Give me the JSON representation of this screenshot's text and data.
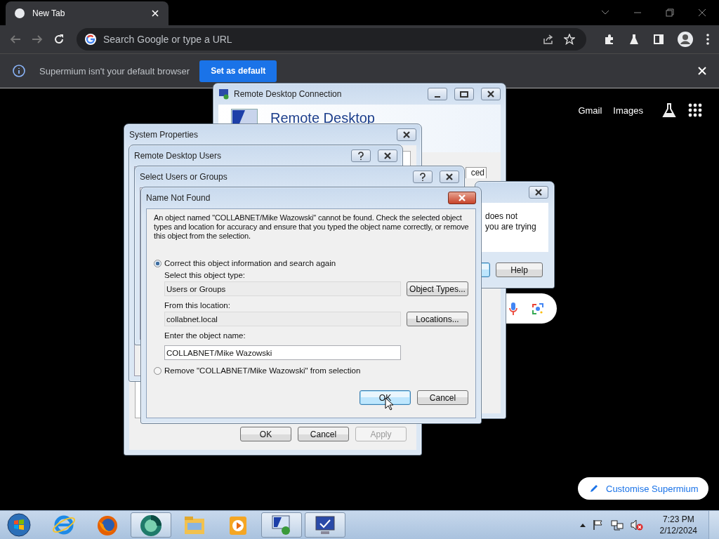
{
  "browser": {
    "tab": {
      "title": "New Tab"
    },
    "address_bar": {
      "placeholder": "Search Google or type a URL"
    },
    "infobar": {
      "message": "Supermium isn't your default browser",
      "button": "Set as default"
    }
  },
  "new_tab_page": {
    "links": [
      "Gmail",
      "Images"
    ],
    "customise_button": "Customise Supermium"
  },
  "windows": [
    {
      "kind": "rdc",
      "title": "Remote Desktop Connection",
      "heading": "Remote Desktop",
      "tab": "ced"
    },
    {
      "kind": "system_properties",
      "title": "System Properties",
      "buttons": [
        {
          "label": "OK",
          "disabled": false
        },
        {
          "label": "Cancel",
          "disabled": false
        },
        {
          "label": "Apply",
          "disabled": true
        }
      ]
    },
    {
      "kind": "remote_users",
      "title": "Remote Desktop Users"
    },
    {
      "kind": "select_users",
      "title": "Select Users or Groups"
    },
    {
      "kind": "message",
      "lines": [
        "does not",
        "you are trying"
      ],
      "button": "Help"
    },
    {
      "kind": "name_not_found",
      "title": "Name Not Found",
      "message": "An object named \"COLLABNET/Mike Wazowski\" cannot be found. Check the selected object types and location for accuracy and ensure that you typed the object name correctly, or remove this object from the selection.",
      "options": [
        {
          "label": "Correct this object information and search again",
          "selected": true
        },
        {
          "label": "Remove \"COLLABNET/Mike Wazowski\" from selection",
          "selected": false
        }
      ],
      "fields": [
        {
          "label": "Select this object type:",
          "value": "Users or Groups",
          "button": "Object Types...",
          "editable": false
        },
        {
          "label": "From this location:",
          "value": "collabnet.local",
          "button": "Locations...",
          "editable": false
        },
        {
          "label": "Enter the object name:",
          "value": "COLLABNET/Mike Wazowski",
          "editable": true
        }
      ],
      "buttons": [
        "OK",
        "Cancel"
      ]
    }
  ],
  "taskbar": {
    "apps": [
      {
        "kind": "ie",
        "running": false
      },
      {
        "kind": "firefox",
        "running": false
      },
      {
        "kind": "circle",
        "running": true
      },
      {
        "kind": "explorer",
        "running": false
      },
      {
        "kind": "media",
        "running": false
      },
      {
        "kind": "rdc",
        "running": true
      },
      {
        "kind": "monitor",
        "running": true
      }
    ],
    "clock": {
      "time": "7:23 PM",
      "date": "2/12/2024"
    }
  }
}
